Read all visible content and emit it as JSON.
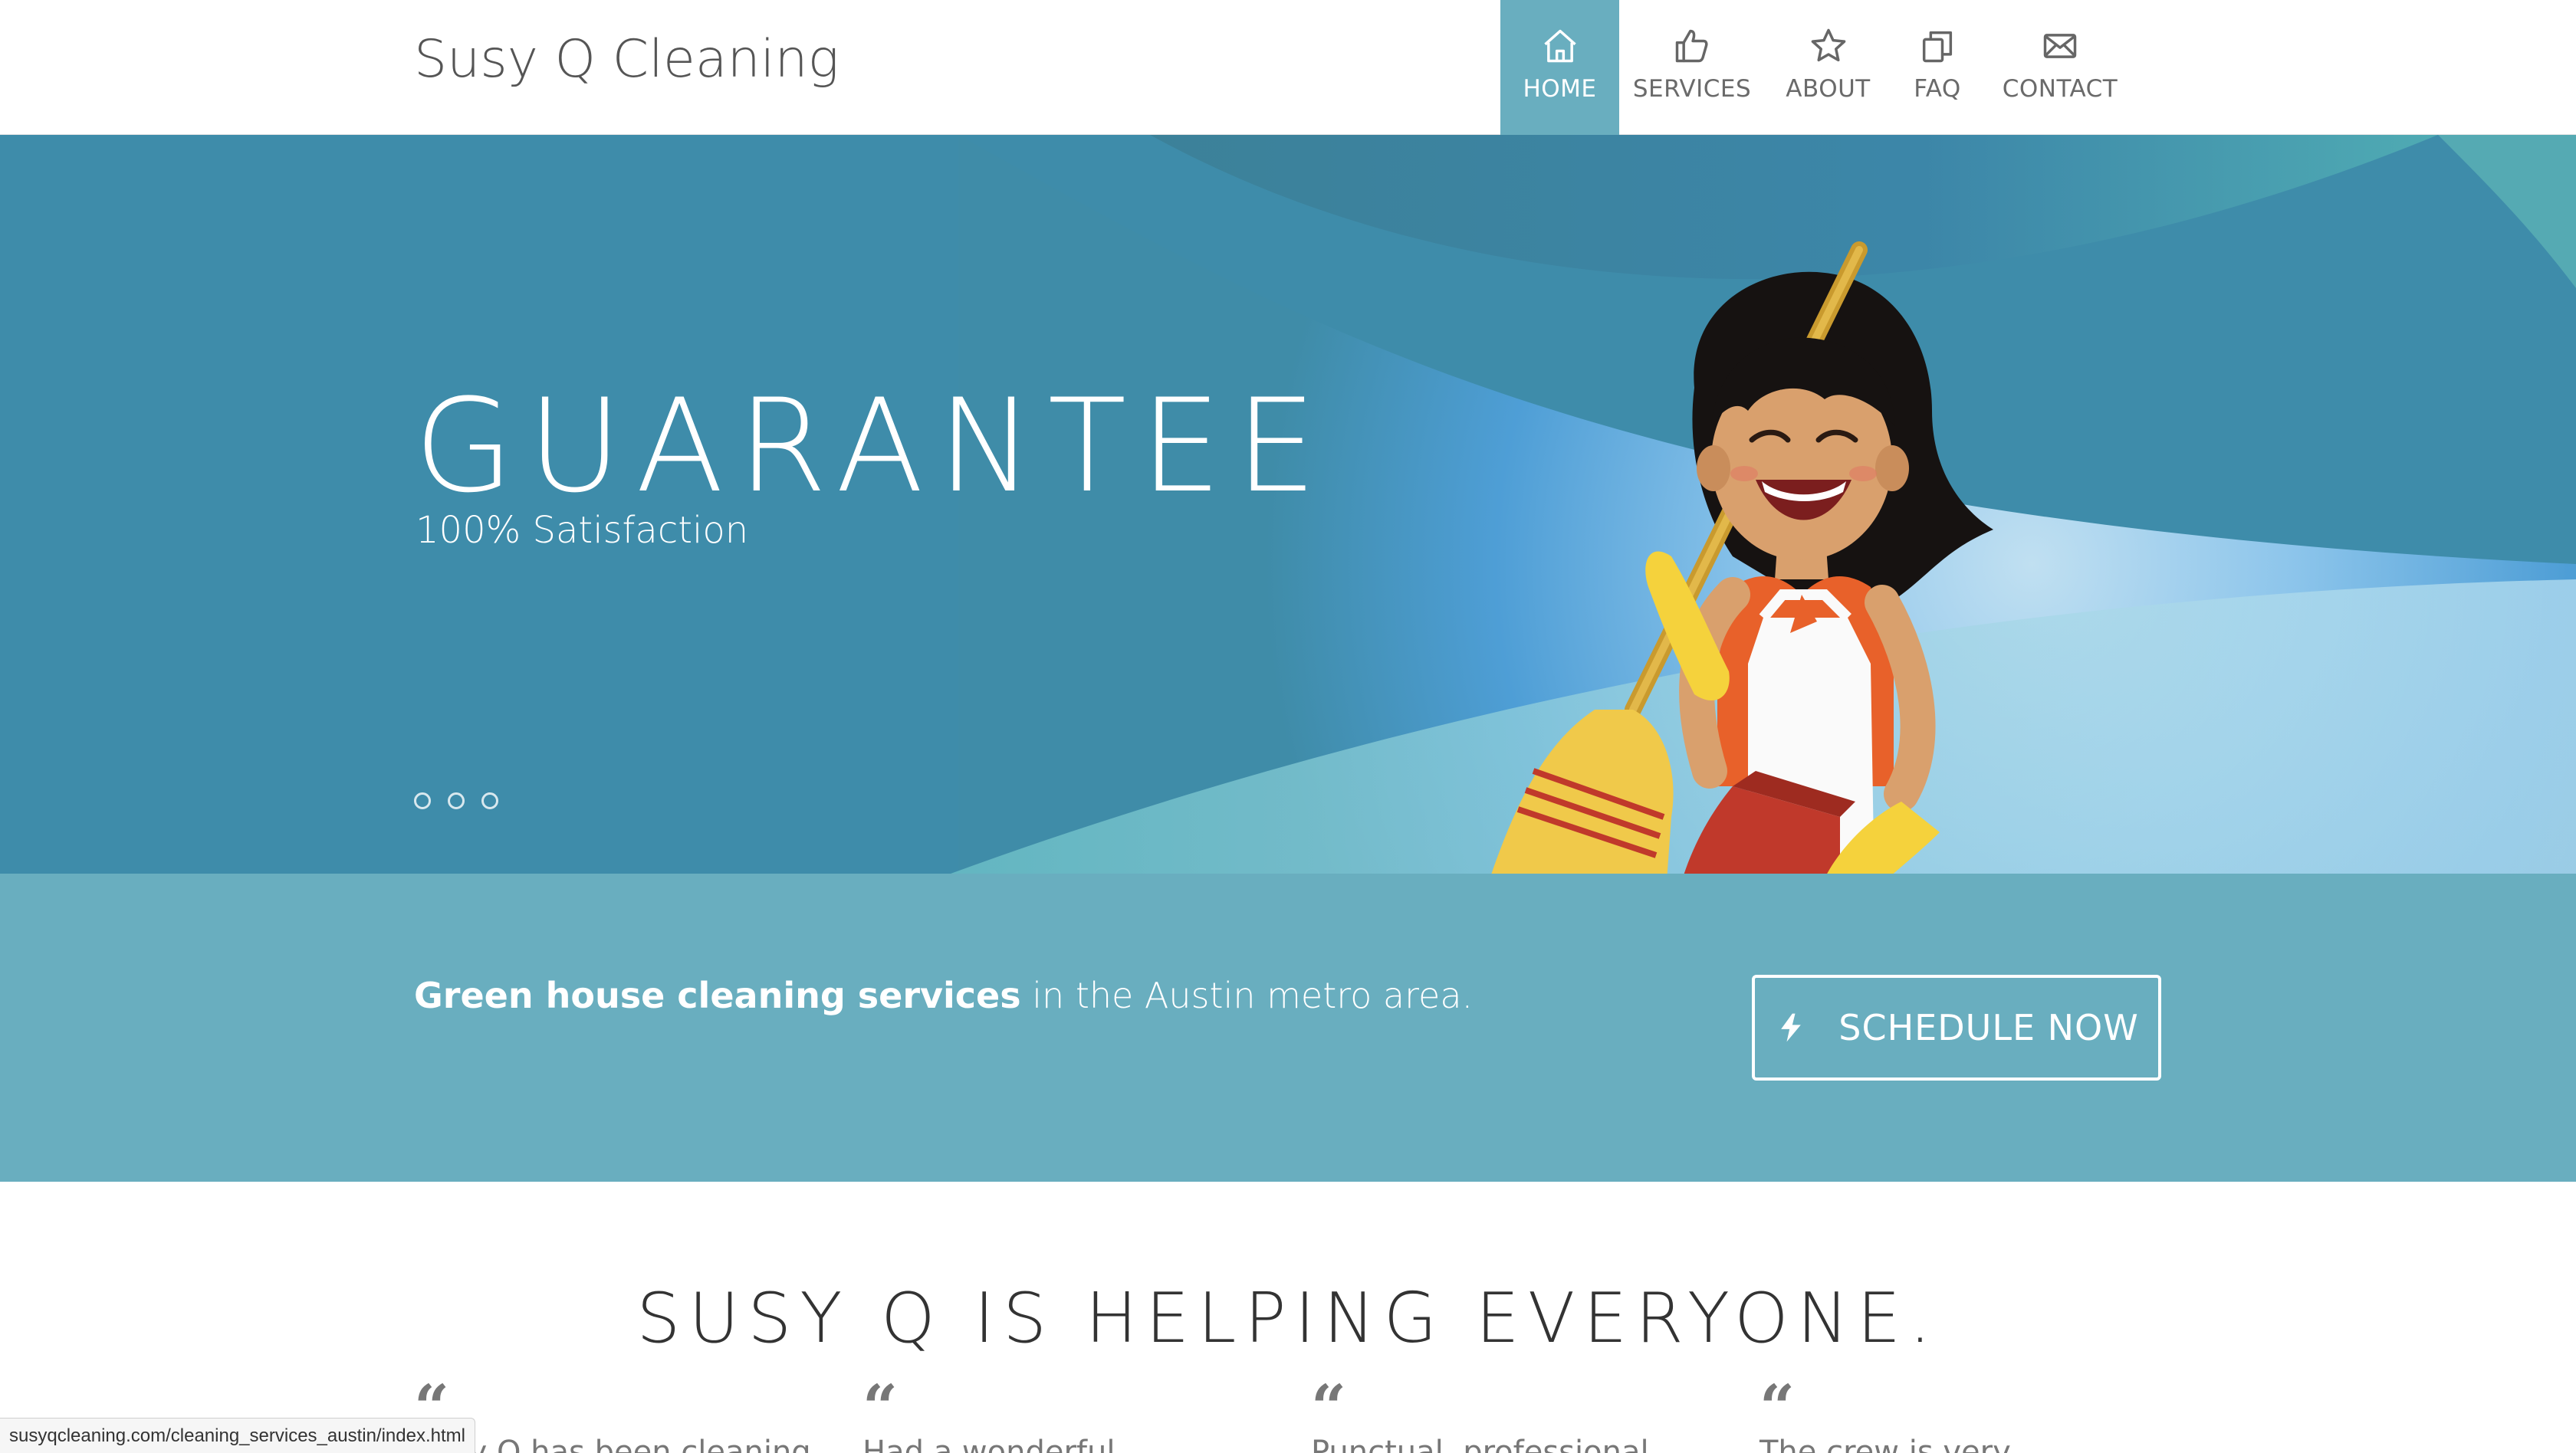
{
  "header": {
    "logo": "Susy Q Cleaning",
    "nav": [
      {
        "label": "HOME",
        "icon": "home-icon",
        "active": true
      },
      {
        "label": "SERVICES",
        "icon": "thumbs-up-icon",
        "active": false
      },
      {
        "label": "ABOUT",
        "icon": "star-icon",
        "active": false
      },
      {
        "label": "FAQ",
        "icon": "copy-icon",
        "active": false
      },
      {
        "label": "CONTACT",
        "icon": "envelope-icon",
        "active": false
      }
    ]
  },
  "hero": {
    "title": "GUARANTEE",
    "subtitle": "100% Satisfaction",
    "slides": 3
  },
  "cta": {
    "bold_text": "Green house cleaning services",
    "rest_text": " in the Austin metro area.",
    "button_label": "SCHEDULE NOW",
    "button_icon": "bolt-icon"
  },
  "testimonials": {
    "heading": "SUSY Q IS HELPING EVERYONE.",
    "items": [
      {
        "text": "Susy Q has been cleaning"
      },
      {
        "text": "Had a wonderful"
      },
      {
        "text": "Punctual, professional"
      },
      {
        "text": "The crew is very"
      }
    ]
  },
  "statusbar": {
    "url": "susyqcleaning.com/cleaning_services_austin/index.html"
  },
  "colors": {
    "accent": "#69aebf",
    "hero_base": "#3f8ca8",
    "text_dark": "#333333"
  }
}
